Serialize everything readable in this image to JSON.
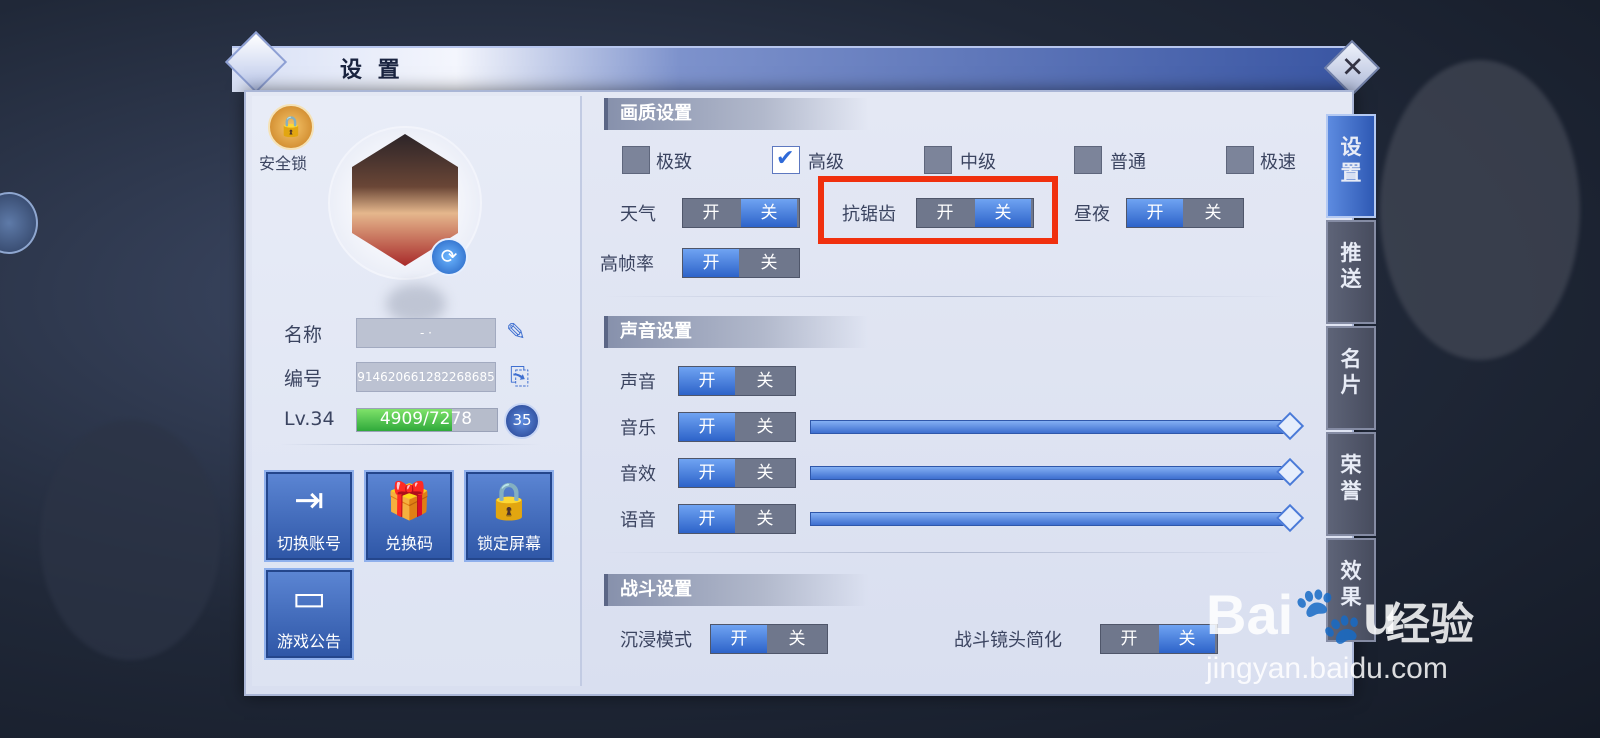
{
  "window": {
    "title": "设 置",
    "close_glyph": "✕"
  },
  "left": {
    "lock_label": "安全锁",
    "name_label": "名称",
    "name_value": "-       ·",
    "id_label": "编号",
    "id_value": "914620661282268685",
    "level_label": "Lv.34",
    "xp_text": "4909/7278",
    "xp_fraction": 0.675,
    "next_level": "35",
    "buttons": [
      {
        "label": "切换账号",
        "icon": "switch-account-icon",
        "glyph": "⇥"
      },
      {
        "label": "兑换码",
        "icon": "gift-icon",
        "glyph": "🎁"
      },
      {
        "label": "锁定屏幕",
        "icon": "lock-screen-icon",
        "glyph": "🔒"
      },
      {
        "label": "游戏公告",
        "icon": "notice-board-icon",
        "glyph": "▭"
      }
    ]
  },
  "graphics": {
    "header": "画质设置",
    "quality_options": [
      {
        "label": "极致",
        "checked": false
      },
      {
        "label": "高级",
        "checked": true
      },
      {
        "label": "中级",
        "checked": false
      },
      {
        "label": "普通",
        "checked": false
      },
      {
        "label": "极速",
        "checked": false
      }
    ],
    "toggles": {
      "weather": {
        "label": "天气",
        "state": "off"
      },
      "antialias": {
        "label": "抗锯齿",
        "state": "off"
      },
      "daynight": {
        "label": "昼夜",
        "state": "on"
      },
      "highfps": {
        "label": "高帧率",
        "state": "on"
      }
    }
  },
  "sound": {
    "header": "声音设置",
    "rows": [
      {
        "label": "声音",
        "state": "on"
      },
      {
        "label": "音乐",
        "state": "on",
        "slider": 1.0
      },
      {
        "label": "音效",
        "state": "on",
        "slider": 1.0
      },
      {
        "label": "语音",
        "state": "on",
        "slider": 1.0
      }
    ]
  },
  "battle": {
    "header": "战斗设置",
    "immersive": {
      "label": "沉浸模式",
      "state": "on"
    },
    "camera": {
      "label": "战斗镜头简化",
      "state": "off"
    }
  },
  "toggle_labels": {
    "on": "开",
    "off": "关"
  },
  "tabs": [
    "设置",
    "推送",
    "名片",
    "荣誉",
    "效果"
  ],
  "active_tab": 0,
  "watermark": {
    "logo": "Bai🐾u",
    "cn": "经验",
    "url": "jingyan.baidu.com"
  },
  "colors": {
    "accent_blue": "#2d63c9",
    "highlight_red": "#f0300e",
    "xp_green": "#2fa93b"
  }
}
